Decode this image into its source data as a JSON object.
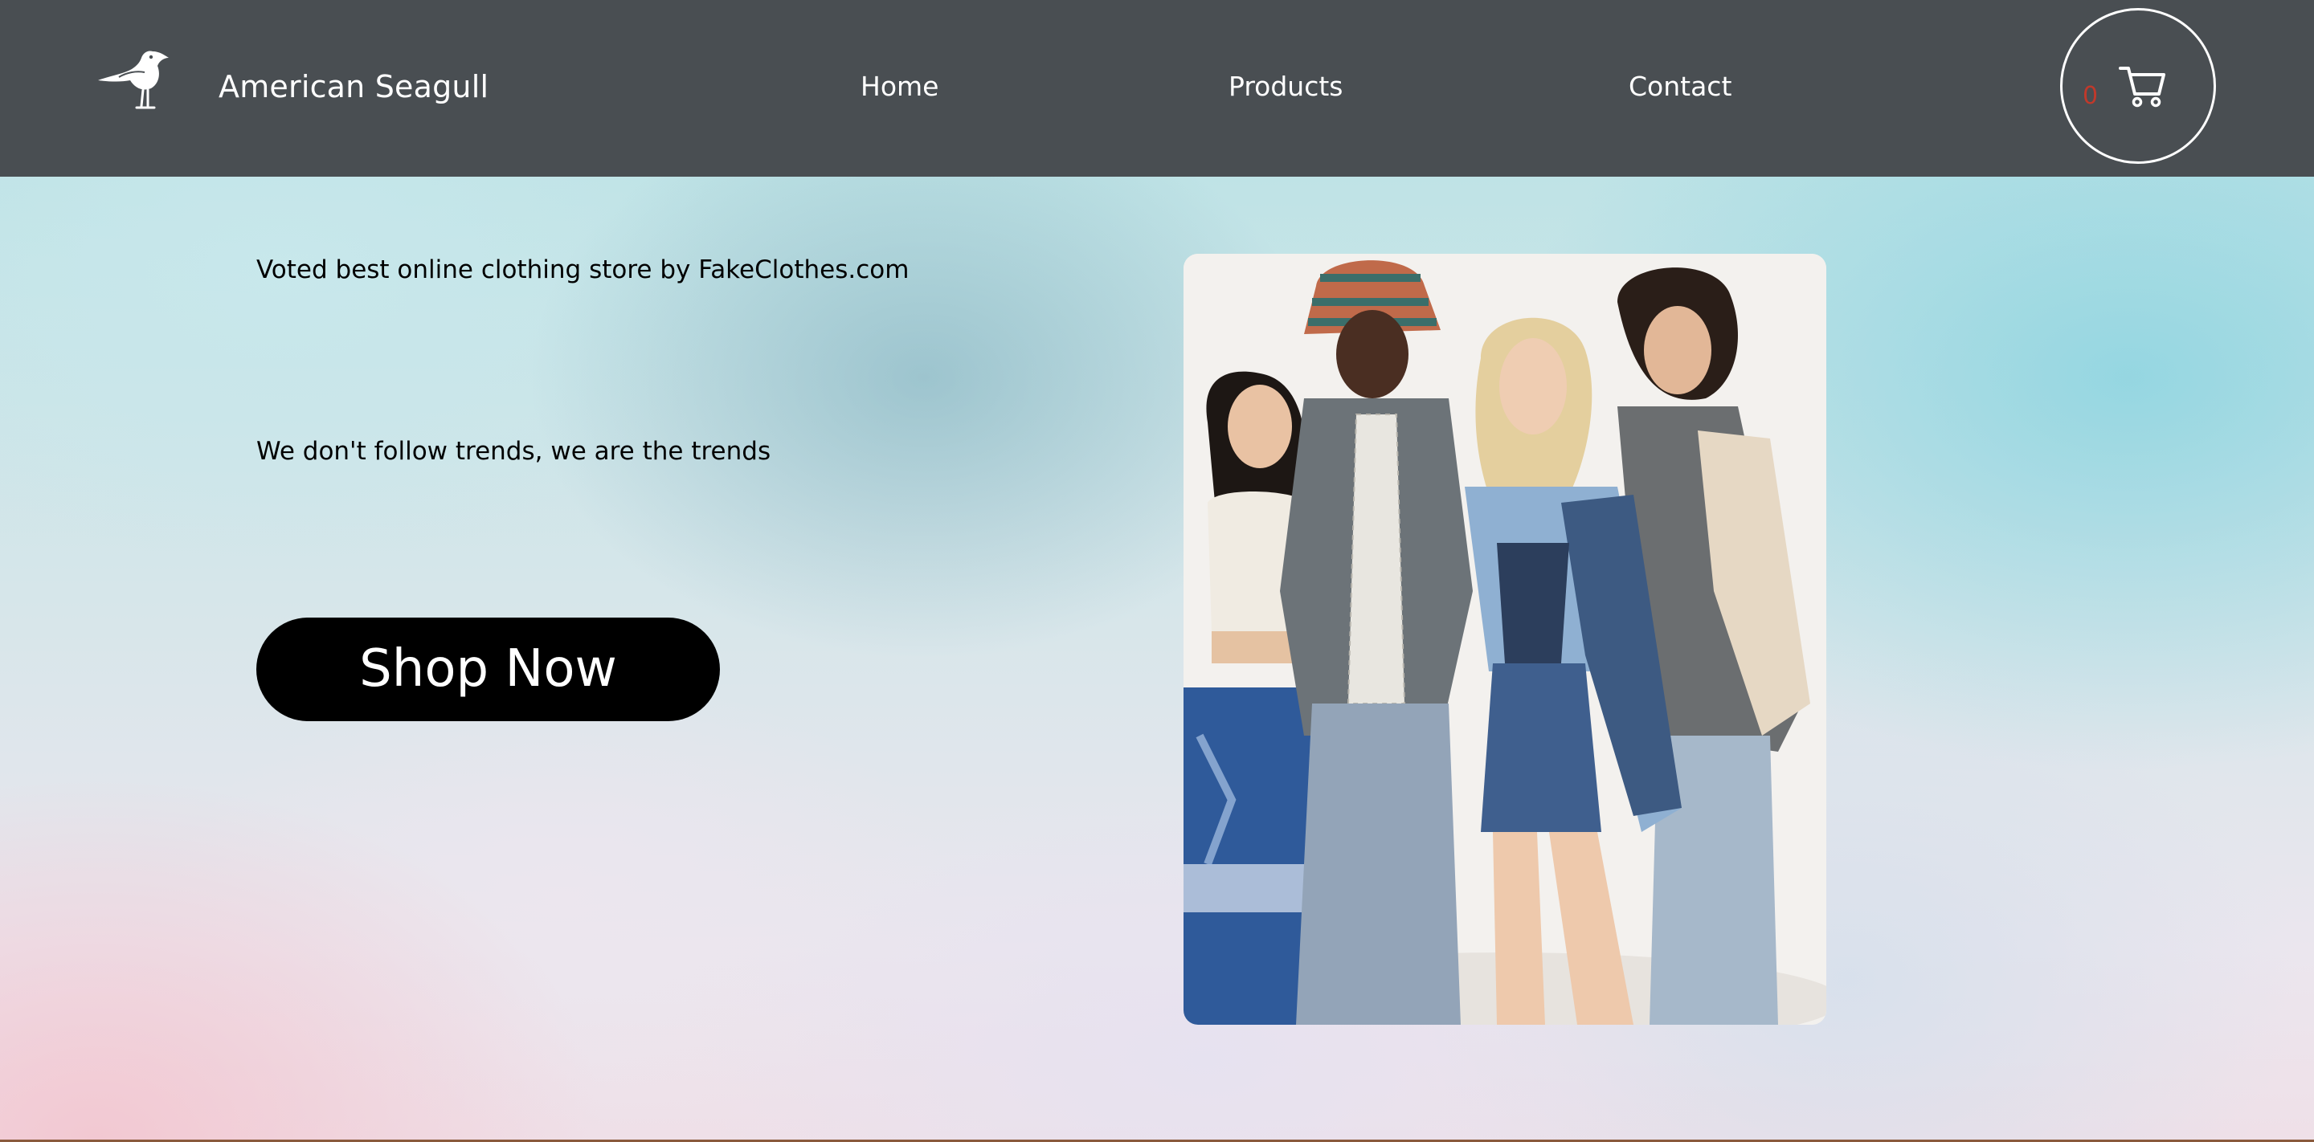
{
  "header": {
    "brand_name": "American Seagull",
    "logo_icon": "seagull-icon",
    "nav": {
      "home": "Home",
      "products": "Products",
      "contact": "Contact"
    },
    "cart": {
      "count": "0",
      "icon": "shopping-cart-icon"
    }
  },
  "hero": {
    "tagline_1": "Voted best online clothing store by FakeClothes.com",
    "tagline_2": "We don't follow trends, we are the trends",
    "cta_label": "Shop Now",
    "image_subject": "group of four models in denim clothing"
  },
  "colors": {
    "header_bg": "#494e52",
    "header_text": "#ffffff",
    "cart_count": "#c0392b",
    "cta_bg": "#000000",
    "cta_text": "#ffffff",
    "body_text": "#000000"
  }
}
